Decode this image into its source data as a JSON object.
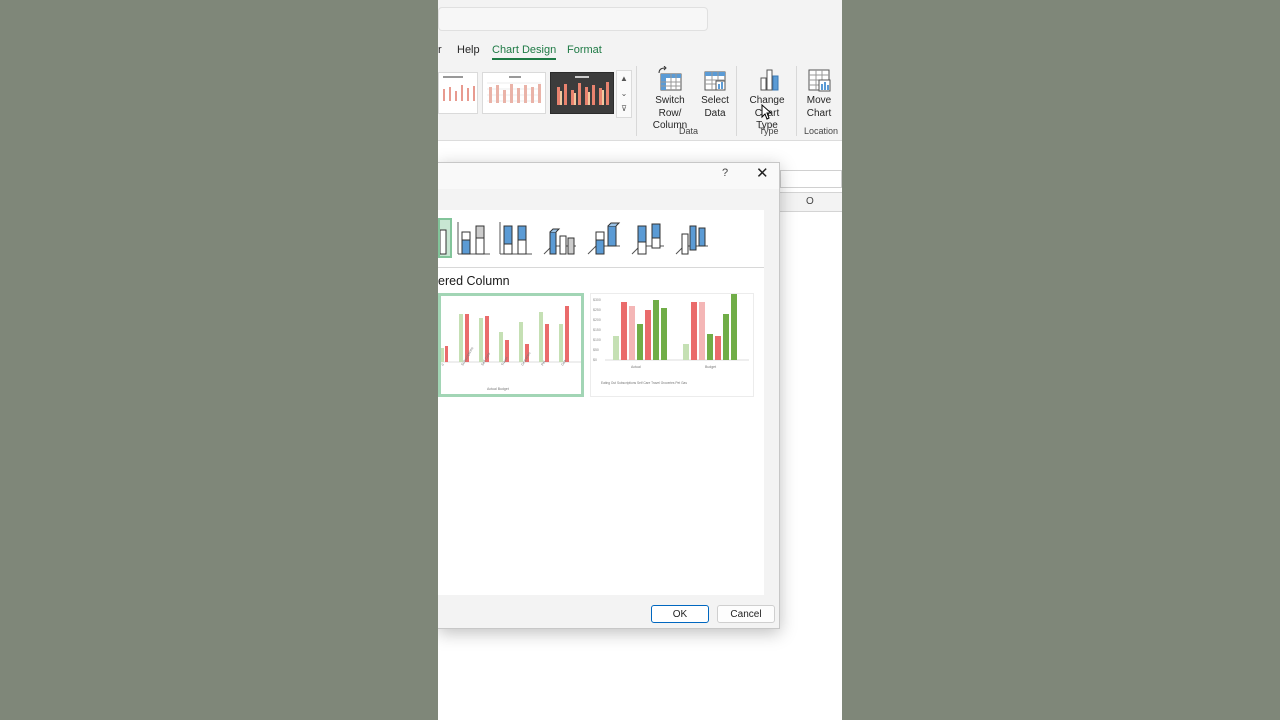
{
  "ribbon": {
    "tabs": {
      "cut": "r",
      "help": "Help",
      "chart_design": "Chart Design",
      "format": "Format"
    },
    "switch_row_col": {
      "line1": "Switch Row/",
      "line2": "Column"
    },
    "select_data": {
      "line1": "Select",
      "line2": "Data"
    },
    "change_chart_type": {
      "line1": "Change",
      "line2": "Chart Type"
    },
    "move_chart": {
      "line1": "Move",
      "line2": "Chart"
    },
    "groups": {
      "data": "Data",
      "type": "Type",
      "location": "Location"
    }
  },
  "sheet": {
    "column_header": "O"
  },
  "dialog": {
    "help": "?",
    "close": "✕",
    "variant_title": "ered Column",
    "ok": "OK",
    "cancel": "Cancel",
    "preview1_categories": [
      "d",
      "Subscriptions",
      "Self Care",
      "Travel",
      "Groceries",
      "Pet",
      "Gas"
    ],
    "preview1_legend": "Actual  Budget",
    "preview2_groups": [
      "Actual",
      "Budget"
    ],
    "preview2_yticks": [
      "$300",
      "$250",
      "$200",
      "$150",
      "$100",
      "$50",
      "$0"
    ],
    "preview2_legend": "Eating Out  Subscriptions  Self Care  Travel  Groceries  Pet  Gas"
  },
  "colors": {
    "accent_green": "#1e7a45",
    "bar_light_green": "#c5e0b4",
    "bar_red": "#ea6b6b",
    "bar_pink": "#f4b6b6",
    "bar_green": "#70ad47",
    "blue_icon": "#5b9bd5"
  }
}
